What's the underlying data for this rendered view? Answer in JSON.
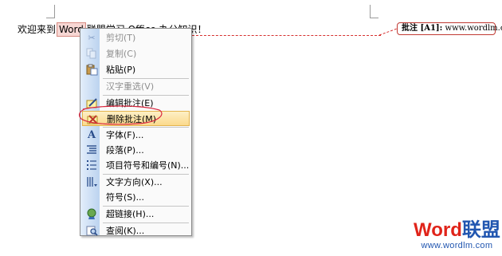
{
  "document": {
    "pre_text": "欢迎来到",
    "highlight_text": "Word",
    "post_text": "联盟学习 Office 办公知识！"
  },
  "comment": {
    "label": "批注 [A1]:",
    "text": "www.wordlm.com"
  },
  "menu": {
    "items": [
      {
        "label": "剪切(T)",
        "icon": "scissors-icon",
        "enabled": false
      },
      {
        "label": "复制(C)",
        "icon": "copy-icon",
        "enabled": false
      },
      {
        "label": "粘贴(P)",
        "icon": "paste-icon",
        "enabled": true
      },
      {
        "label": "汉字重选(V)",
        "icon": "",
        "enabled": false
      },
      {
        "label": "编辑批注(E)",
        "icon": "edit-comment-icon",
        "enabled": true
      },
      {
        "label": "删除批注(M)",
        "icon": "delete-comment-icon",
        "enabled": true,
        "highlighted": true
      },
      {
        "label": "字体(F)...",
        "icon": "font-icon",
        "enabled": true
      },
      {
        "label": "段落(P)...",
        "icon": "paragraph-icon",
        "enabled": true
      },
      {
        "label": "项目符号和编号(N)...",
        "icon": "bullets-icon",
        "enabled": true
      },
      {
        "label": "文字方向(X)...",
        "icon": "text-direction-icon",
        "enabled": true
      },
      {
        "label": "符号(S)...",
        "icon": "",
        "enabled": true
      },
      {
        "label": "超链接(H)...",
        "icon": "hyperlink-icon",
        "enabled": true
      },
      {
        "label": "查阅(K)...",
        "icon": "lookup-icon",
        "enabled": true
      }
    ]
  },
  "brand": {
    "word": "Word",
    "lianmeng": "联盟",
    "url": "www.wordlm.com"
  },
  "colors": {
    "brand_red": "#e0241a",
    "brand_blue": "#2156b0",
    "comment_red": "#c03a33",
    "highlight_bg": "#f7d7d4",
    "menu_hot": "#fbd98c"
  }
}
